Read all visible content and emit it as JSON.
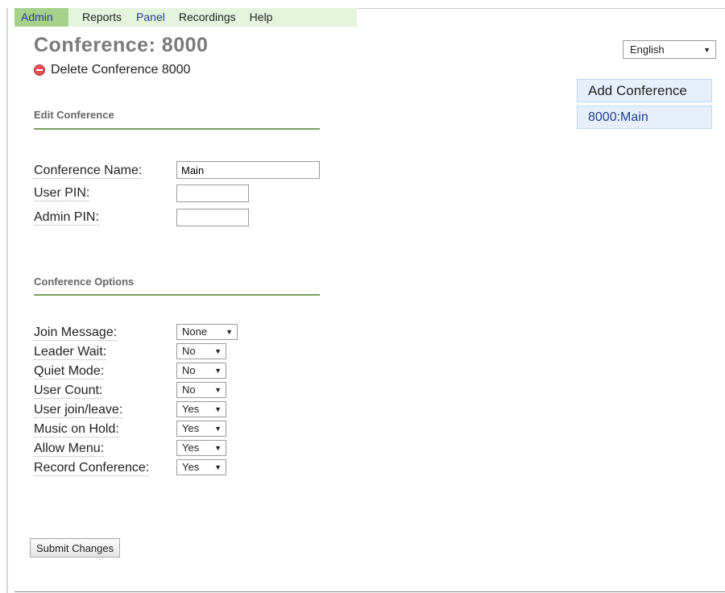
{
  "nav": {
    "items": [
      {
        "label": "Admin",
        "active": true
      },
      {
        "label": "Reports"
      },
      {
        "label": "Panel"
      },
      {
        "label": "Recordings"
      },
      {
        "label": "Help"
      }
    ]
  },
  "page": {
    "title": "Conference: 8000",
    "delete_label": "Delete Conference 8000"
  },
  "language": {
    "selected": "English"
  },
  "sidebar": {
    "add_label": "Add Conference",
    "items": [
      {
        "label": "8000:Main"
      }
    ]
  },
  "edit_section": {
    "title": "Edit Conference",
    "fields": {
      "name": {
        "label": "Conference Name:",
        "value": "Main"
      },
      "user_pin": {
        "label": "User PIN:",
        "value": ""
      },
      "admin_pin": {
        "label": "Admin PIN:",
        "value": ""
      }
    }
  },
  "options_section": {
    "title": "Conference Options",
    "options": [
      {
        "label": "Join Message:",
        "value": "None"
      },
      {
        "label": "Leader Wait:",
        "value": "No"
      },
      {
        "label": "Quiet Mode:",
        "value": "No"
      },
      {
        "label": "User Count:",
        "value": "No"
      },
      {
        "label": "User join/leave:",
        "value": "Yes"
      },
      {
        "label": "Music on Hold:",
        "value": "Yes"
      },
      {
        "label": "Allow Menu:",
        "value": "Yes"
      },
      {
        "label": "Record Conference:",
        "value": "Yes"
      }
    ]
  },
  "submit_label": "Submit Changes",
  "colors": {
    "nav_bg": "#e4f3dc",
    "nav_active": "#a6d18a",
    "section_rule": "#7aa05f",
    "sidebar_bg": "#e7f0fa",
    "delete_icon": "#e0525a"
  },
  "icons": {
    "delete": "minus-circle-icon",
    "dropdown": "chevron-down-icon"
  }
}
